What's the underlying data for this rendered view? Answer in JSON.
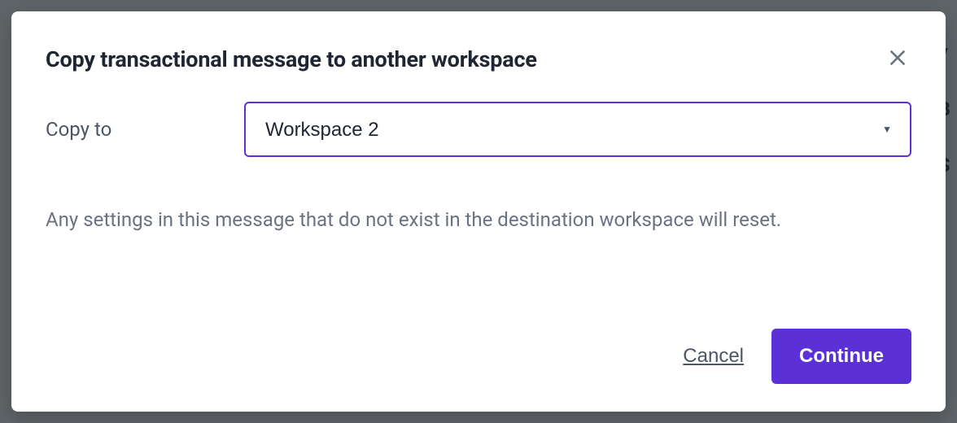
{
  "background": {
    "hint_chars": "v\nB\nS"
  },
  "modal": {
    "title": "Copy transactional message to another workspace",
    "copy_to_label": "Copy to",
    "selected_workspace": "Workspace 2",
    "helper_text": "Any settings in this message that do not exist in the destination workspace will reset.",
    "cancel_label": "Cancel",
    "continue_label": "Continue"
  }
}
